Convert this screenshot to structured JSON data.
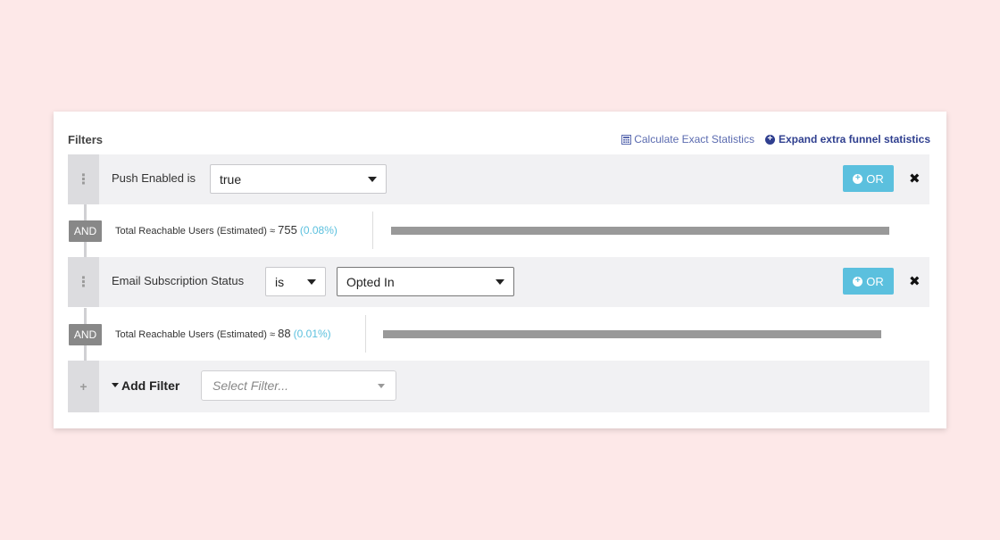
{
  "header": {
    "title": "Filters",
    "calc_link": "Calculate Exact Statistics",
    "expand_link": "Expand extra funnel statistics"
  },
  "filters": [
    {
      "label": "Push Enabled is",
      "value": "true",
      "or_label": "OR",
      "remove": "✖",
      "handle": "⋮"
    },
    {
      "label": "Email Subscription Status",
      "operator": "is",
      "value": "Opted In",
      "or_label": "OR",
      "remove": "✖",
      "handle": "⋮"
    }
  ],
  "stats": [
    {
      "and_label": "AND",
      "label": "Total Reachable Users (Estimated) ≈ ",
      "count": "755",
      "pct": "(0.08%)",
      "fill": 1.0
    },
    {
      "and_label": "AND",
      "label": "Total Reachable Users (Estimated) ≈ ",
      "count": "88",
      "pct": "(0.01%)",
      "fill": 1.0
    }
  ],
  "add_filter": {
    "handle": "+",
    "label": "Add Filter",
    "placeholder": "Select Filter..."
  },
  "colors": {
    "background": "#fde8e8",
    "accent": "#5bc0de",
    "link": "#2f3f8f",
    "bar": "#999999"
  }
}
